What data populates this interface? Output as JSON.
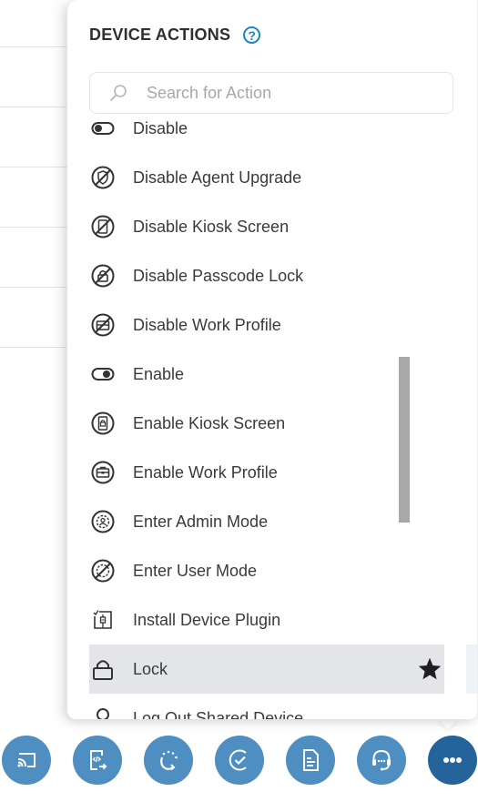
{
  "popup": {
    "title": "DEVICE ACTIONS",
    "help_icon": "question-circle-icon",
    "search": {
      "placeholder": "Search for Action",
      "value": ""
    }
  },
  "actions": [
    {
      "label": "Disable",
      "icon": "toggle-off-icon"
    },
    {
      "label": "Disable Agent Upgrade",
      "icon": "agent-upgrade-disabled-icon"
    },
    {
      "label": "Disable Kiosk Screen",
      "icon": "kiosk-disabled-icon"
    },
    {
      "label": "Disable Passcode Lock",
      "icon": "passcode-lock-disabled-icon"
    },
    {
      "label": "Disable Work Profile",
      "icon": "work-profile-disabled-icon"
    },
    {
      "label": "Enable",
      "icon": "toggle-on-icon"
    },
    {
      "label": "Enable Kiosk Screen",
      "icon": "kiosk-icon"
    },
    {
      "label": "Enable Work Profile",
      "icon": "briefcase-icon"
    },
    {
      "label": "Enter Admin Mode",
      "icon": "gear-user-icon"
    },
    {
      "label": "Enter User Mode",
      "icon": "gear-disabled-icon"
    },
    {
      "label": "Install Device Plugin",
      "icon": "plugin-icon"
    },
    {
      "label": "Lock",
      "icon": "lock-icon",
      "hovered": true,
      "favorite": true
    },
    {
      "label": "Log Out Shared Device",
      "icon": "user-icon"
    }
  ],
  "colors": {
    "accent": "#1a86c7",
    "action_button": "#4f8ec0",
    "action_button_active": "#24649b",
    "hover_row": "#e3e5e8"
  },
  "action_bar": [
    {
      "name": "cast-button",
      "icon": "cast-icon"
    },
    {
      "name": "remote-script-button",
      "icon": "script-transfer-icon"
    },
    {
      "name": "refresh-button",
      "icon": "refresh-icon"
    },
    {
      "name": "check-compliance-button",
      "icon": "check-circle-icon"
    },
    {
      "name": "document-button",
      "icon": "document-icon"
    },
    {
      "name": "support-button",
      "icon": "headset-icon"
    },
    {
      "name": "more-actions-button",
      "icon": "more-dots-icon",
      "active": true
    }
  ]
}
